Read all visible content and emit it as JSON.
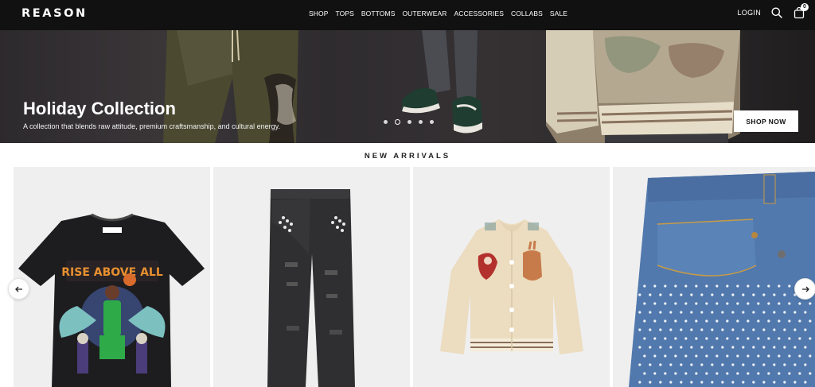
{
  "header": {
    "logo": "REASON",
    "nav": [
      "SHOP",
      "TOPS",
      "BOTTOMS",
      "OUTERWEAR",
      "ACCESSORIES",
      "COLLABS",
      "SALE"
    ],
    "login_label": "LOGIN",
    "cart_count": "0",
    "icons": [
      "search-icon",
      "cart-icon"
    ]
  },
  "hero": {
    "title": "Holiday Collection",
    "subtitle": "A collection that blends raw attitude, premium craftsmanship, and cultural energy.",
    "cta_label": "SHOP NOW",
    "slide_count": 5,
    "active_slide": 2
  },
  "new_arrivals": {
    "title": "NEW ARRIVALS",
    "tshirt_print_text": "RISE ABOVE ALL",
    "carousel_icons": [
      "arrow-left-icon",
      "arrow-right-icon"
    ]
  },
  "colors": {
    "header_bg": "#111111",
    "card_bg": "#efefef",
    "text": "#222222"
  }
}
